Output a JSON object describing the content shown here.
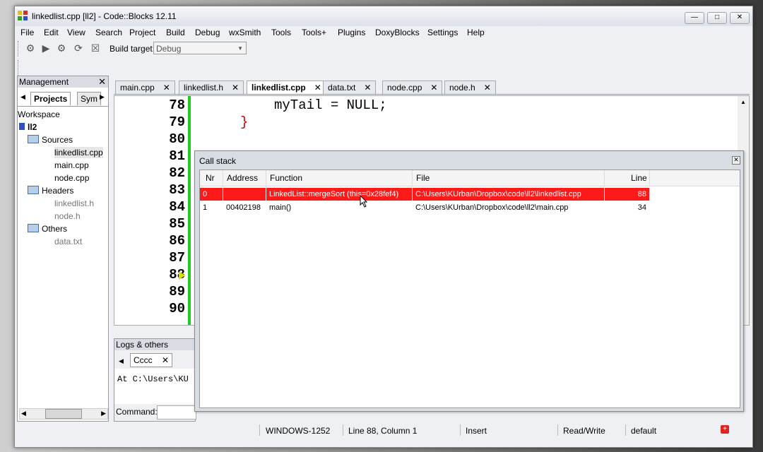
{
  "window": {
    "title": "linkedlist.cpp [ll2] - Code::Blocks 12.11"
  },
  "menu": [
    "File",
    "Edit",
    "View",
    "Search",
    "Project",
    "Build",
    "Debug",
    "wxSmith",
    "Tools",
    "Tools+",
    "Plugins",
    "DoxyBlocks",
    "Settings",
    "Help"
  ],
  "toolbar": {
    "build_target_label": "Build target:",
    "build_target_value": "Debug"
  },
  "management": {
    "title": "Management",
    "tabs": [
      "Projects",
      "Sym"
    ],
    "tree": {
      "workspace": "Workspace",
      "project": "ll2",
      "sources": "Sources",
      "sources_files": [
        "linkedlist.cpp",
        "main.cpp",
        "node.cpp"
      ],
      "headers": "Headers",
      "headers_files": [
        "linkedlist.h",
        "node.h"
      ],
      "others": "Others",
      "others_files": [
        "data.txt"
      ]
    }
  },
  "editor": {
    "tabs": [
      "main.cpp",
      "linkedlist.h",
      "linkedlist.cpp",
      "data.txt",
      "node.cpp",
      "node.h"
    ],
    "active_tab": "linkedlist.cpp",
    "line_numbers": [
      "78",
      "79",
      "80",
      "81",
      "82",
      "83",
      "84",
      "85",
      "86",
      "87",
      "88",
      "89",
      "90"
    ],
    "code_line_78": "myTail = NULL;",
    "code_line_79": "}"
  },
  "logs": {
    "title": "Logs & others",
    "tab": "Cccc",
    "text": "At C:\\Users\\KU",
    "command_label": "Command:"
  },
  "callstack": {
    "title": "Call stack",
    "columns": [
      "Nr",
      "Address",
      "Function",
      "File",
      "Line"
    ],
    "rows": [
      {
        "nr": "0",
        "address": "",
        "function": "LinkedList::mergeSort (this=0x28fef4)",
        "file": "C:\\Users\\KUrban\\Dropbox\\code\\ll2\\linkedlist.cpp",
        "line": "88"
      },
      {
        "nr": "1",
        "address": "00402198",
        "function": "main()",
        "file": "C:\\Users\\KUrban\\Dropbox\\code\\ll2\\main.cpp",
        "line": "34"
      }
    ],
    "highlight_color": "#ff1a1a"
  },
  "status": {
    "encoding": "WINDOWS-1252",
    "position": "Line 88, Column 1",
    "mode": "Insert",
    "access": "Read/Write",
    "profile": "default"
  }
}
